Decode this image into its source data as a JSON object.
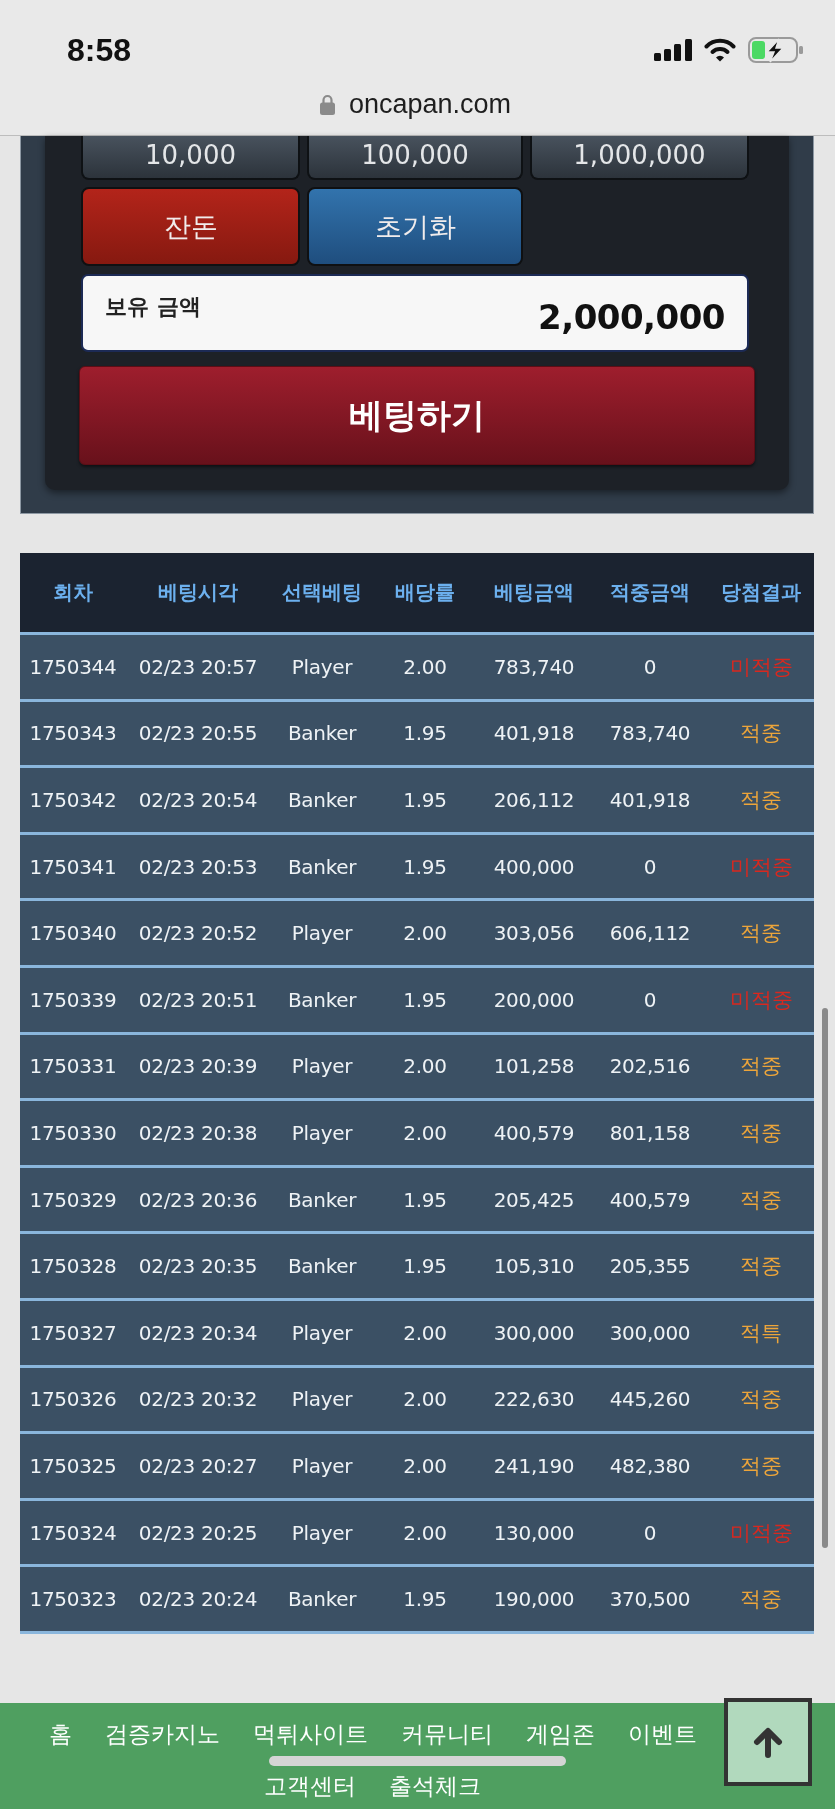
{
  "status_bar": {
    "time": "8:58"
  },
  "address_bar": {
    "url": "oncapan.com"
  },
  "bet_panel": {
    "chip_buttons": [
      "10,000",
      "100,000",
      "1,000,000"
    ],
    "action_buttons": [
      {
        "label": "잔돈",
        "kind": "danger"
      },
      {
        "label": "초기화",
        "kind": "primary"
      }
    ],
    "balance": {
      "label": "보유 금액",
      "value": "2,000,000"
    },
    "submit_button": "베팅하기"
  },
  "history_table": {
    "columns": [
      "회차",
      "베팅시각",
      "선택베팅",
      "배당률",
      "베팅금액",
      "적중금액",
      "당첨결과"
    ],
    "rows": [
      {
        "cells": [
          "1750344",
          "02/23 20:57",
          "Player",
          "2.00",
          "783,740",
          "0",
          "미적중"
        ],
        "color": "#d8281f"
      },
      {
        "cells": [
          "1750343",
          "02/23 20:55",
          "Banker",
          "1.95",
          "401,918",
          "783,740",
          "적중"
        ],
        "color": "#eda53a"
      },
      {
        "cells": [
          "1750342",
          "02/23 20:54",
          "Banker",
          "1.95",
          "206,112",
          "401,918",
          "적중"
        ],
        "color": "#eda53a"
      },
      {
        "cells": [
          "1750341",
          "02/23 20:53",
          "Banker",
          "1.95",
          "400,000",
          "0",
          "미적중"
        ],
        "color": "#d8281f"
      },
      {
        "cells": [
          "1750340",
          "02/23 20:52",
          "Player",
          "2.00",
          "303,056",
          "606,112",
          "적중"
        ],
        "color": "#eda53a"
      },
      {
        "cells": [
          "1750339",
          "02/23 20:51",
          "Banker",
          "1.95",
          "200,000",
          "0",
          "미적중"
        ],
        "color": "#d8281f"
      },
      {
        "cells": [
          "1750331",
          "02/23 20:39",
          "Player",
          "2.00",
          "101,258",
          "202,516",
          "적중"
        ],
        "color": "#eda53a"
      },
      {
        "cells": [
          "1750330",
          "02/23 20:38",
          "Player",
          "2.00",
          "400,579",
          "801,158",
          "적중"
        ],
        "color": "#eda53a"
      },
      {
        "cells": [
          "1750329",
          "02/23 20:36",
          "Banker",
          "1.95",
          "205,425",
          "400,579",
          "적중"
        ],
        "color": "#eda53a"
      },
      {
        "cells": [
          "1750328",
          "02/23 20:35",
          "Banker",
          "1.95",
          "105,310",
          "205,355",
          "적중"
        ],
        "color": "#eda53a"
      },
      {
        "cells": [
          "1750327",
          "02/23 20:34",
          "Player",
          "2.00",
          "300,000",
          "300,000",
          "적특"
        ],
        "color": "#eda53a"
      },
      {
        "cells": [
          "1750326",
          "02/23 20:32",
          "Player",
          "2.00",
          "222,630",
          "445,260",
          "적중"
        ],
        "color": "#eda53a"
      },
      {
        "cells": [
          "1750325",
          "02/23 20:27",
          "Player",
          "2.00",
          "241,190",
          "482,380",
          "적중"
        ],
        "color": "#eda53a"
      },
      {
        "cells": [
          "1750324",
          "02/23 20:25",
          "Player",
          "2.00",
          "130,000",
          "0",
          "미적중"
        ],
        "color": "#d8281f"
      },
      {
        "cells": [
          "1750323",
          "02/23 20:24",
          "Banker",
          "1.95",
          "190,000",
          "370,500",
          "적중"
        ],
        "color": "#eda53a"
      }
    ]
  },
  "bottom_nav": {
    "items": [
      "홈",
      "검증카지노",
      "먹튀사이트",
      "커뮤니티",
      "게임존",
      "이벤트",
      "고객센터",
      "출석체크"
    ]
  }
}
